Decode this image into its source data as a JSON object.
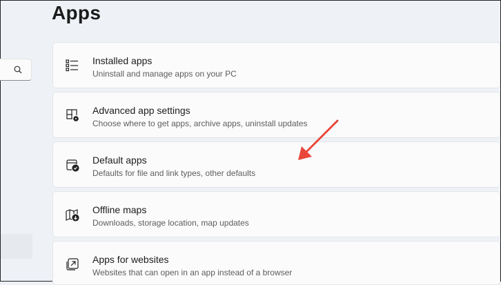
{
  "page": {
    "title": "Apps"
  },
  "search": {
    "icon": "search-icon"
  },
  "cards": [
    {
      "title": "Installed apps",
      "subtitle": "Uninstall and manage apps on your PC",
      "icon": "list-icon"
    },
    {
      "title": "Advanced app settings",
      "subtitle": "Choose where to get apps, archive apps, uninstall updates",
      "icon": "app-settings-icon"
    },
    {
      "title": "Default apps",
      "subtitle": "Defaults for file and link types, other defaults",
      "icon": "default-apps-icon"
    },
    {
      "title": "Offline maps",
      "subtitle": "Downloads, storage location, map updates",
      "icon": "map-download-icon"
    },
    {
      "title": "Apps for websites",
      "subtitle": "Websites that can open in an app instead of a browser",
      "icon": "open-external-icon"
    }
  ],
  "annotation": {
    "color": "#e8473a"
  }
}
